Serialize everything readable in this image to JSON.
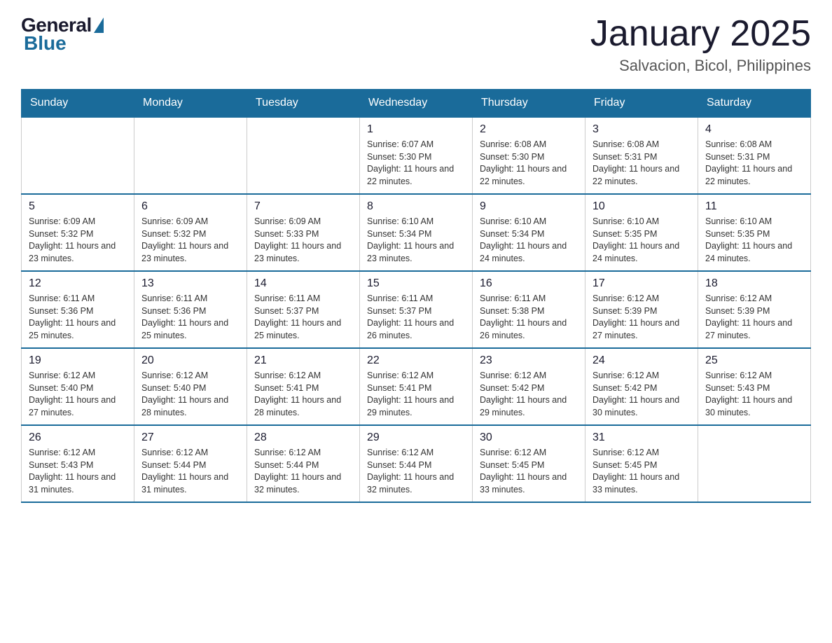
{
  "logo": {
    "general": "General",
    "blue": "Blue"
  },
  "header": {
    "month_year": "January 2025",
    "location": "Salvacion, Bicol, Philippines"
  },
  "days_of_week": [
    "Sunday",
    "Monday",
    "Tuesday",
    "Wednesday",
    "Thursday",
    "Friday",
    "Saturday"
  ],
  "weeks": [
    [
      null,
      null,
      null,
      {
        "day": 1,
        "sunrise": "6:07 AM",
        "sunset": "5:30 PM",
        "daylight": "11 hours and 22 minutes."
      },
      {
        "day": 2,
        "sunrise": "6:08 AM",
        "sunset": "5:30 PM",
        "daylight": "11 hours and 22 minutes."
      },
      {
        "day": 3,
        "sunrise": "6:08 AM",
        "sunset": "5:31 PM",
        "daylight": "11 hours and 22 minutes."
      },
      {
        "day": 4,
        "sunrise": "6:08 AM",
        "sunset": "5:31 PM",
        "daylight": "11 hours and 22 minutes."
      }
    ],
    [
      {
        "day": 5,
        "sunrise": "6:09 AM",
        "sunset": "5:32 PM",
        "daylight": "11 hours and 23 minutes."
      },
      {
        "day": 6,
        "sunrise": "6:09 AM",
        "sunset": "5:32 PM",
        "daylight": "11 hours and 23 minutes."
      },
      {
        "day": 7,
        "sunrise": "6:09 AM",
        "sunset": "5:33 PM",
        "daylight": "11 hours and 23 minutes."
      },
      {
        "day": 8,
        "sunrise": "6:10 AM",
        "sunset": "5:34 PM",
        "daylight": "11 hours and 23 minutes."
      },
      {
        "day": 9,
        "sunrise": "6:10 AM",
        "sunset": "5:34 PM",
        "daylight": "11 hours and 24 minutes."
      },
      {
        "day": 10,
        "sunrise": "6:10 AM",
        "sunset": "5:35 PM",
        "daylight": "11 hours and 24 minutes."
      },
      {
        "day": 11,
        "sunrise": "6:10 AM",
        "sunset": "5:35 PM",
        "daylight": "11 hours and 24 minutes."
      }
    ],
    [
      {
        "day": 12,
        "sunrise": "6:11 AM",
        "sunset": "5:36 PM",
        "daylight": "11 hours and 25 minutes."
      },
      {
        "day": 13,
        "sunrise": "6:11 AM",
        "sunset": "5:36 PM",
        "daylight": "11 hours and 25 minutes."
      },
      {
        "day": 14,
        "sunrise": "6:11 AM",
        "sunset": "5:37 PM",
        "daylight": "11 hours and 25 minutes."
      },
      {
        "day": 15,
        "sunrise": "6:11 AM",
        "sunset": "5:37 PM",
        "daylight": "11 hours and 26 minutes."
      },
      {
        "day": 16,
        "sunrise": "6:11 AM",
        "sunset": "5:38 PM",
        "daylight": "11 hours and 26 minutes."
      },
      {
        "day": 17,
        "sunrise": "6:12 AM",
        "sunset": "5:39 PM",
        "daylight": "11 hours and 27 minutes."
      },
      {
        "day": 18,
        "sunrise": "6:12 AM",
        "sunset": "5:39 PM",
        "daylight": "11 hours and 27 minutes."
      }
    ],
    [
      {
        "day": 19,
        "sunrise": "6:12 AM",
        "sunset": "5:40 PM",
        "daylight": "11 hours and 27 minutes."
      },
      {
        "day": 20,
        "sunrise": "6:12 AM",
        "sunset": "5:40 PM",
        "daylight": "11 hours and 28 minutes."
      },
      {
        "day": 21,
        "sunrise": "6:12 AM",
        "sunset": "5:41 PM",
        "daylight": "11 hours and 28 minutes."
      },
      {
        "day": 22,
        "sunrise": "6:12 AM",
        "sunset": "5:41 PM",
        "daylight": "11 hours and 29 minutes."
      },
      {
        "day": 23,
        "sunrise": "6:12 AM",
        "sunset": "5:42 PM",
        "daylight": "11 hours and 29 minutes."
      },
      {
        "day": 24,
        "sunrise": "6:12 AM",
        "sunset": "5:42 PM",
        "daylight": "11 hours and 30 minutes."
      },
      {
        "day": 25,
        "sunrise": "6:12 AM",
        "sunset": "5:43 PM",
        "daylight": "11 hours and 30 minutes."
      }
    ],
    [
      {
        "day": 26,
        "sunrise": "6:12 AM",
        "sunset": "5:43 PM",
        "daylight": "11 hours and 31 minutes."
      },
      {
        "day": 27,
        "sunrise": "6:12 AM",
        "sunset": "5:44 PM",
        "daylight": "11 hours and 31 minutes."
      },
      {
        "day": 28,
        "sunrise": "6:12 AM",
        "sunset": "5:44 PM",
        "daylight": "11 hours and 32 minutes."
      },
      {
        "day": 29,
        "sunrise": "6:12 AM",
        "sunset": "5:44 PM",
        "daylight": "11 hours and 32 minutes."
      },
      {
        "day": 30,
        "sunrise": "6:12 AM",
        "sunset": "5:45 PM",
        "daylight": "11 hours and 33 minutes."
      },
      {
        "day": 31,
        "sunrise": "6:12 AM",
        "sunset": "5:45 PM",
        "daylight": "11 hours and 33 minutes."
      },
      null
    ]
  ]
}
